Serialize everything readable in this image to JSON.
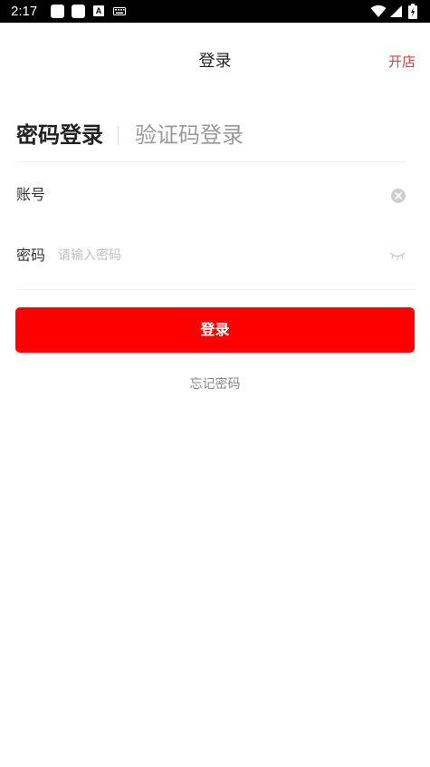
{
  "status_bar": {
    "time": "2:17",
    "icons": [
      "notification-square-icon",
      "notification-square-icon",
      "a-box-icon",
      "keyboard-icon",
      "wifi-icon",
      "signal-icon",
      "battery-icon"
    ]
  },
  "header": {
    "title": "登录",
    "action_label": "开店",
    "action_color": "#e4393c"
  },
  "tabs": {
    "active": "密码登录",
    "inactive": "验证码登录"
  },
  "form": {
    "account": {
      "label": "账号",
      "value": "",
      "placeholder": "",
      "trailing_icon": "clear-icon"
    },
    "password": {
      "label": "密码",
      "value": "",
      "placeholder": "请输入密码",
      "trailing_icon": "eye-closed-icon"
    }
  },
  "submit": {
    "label": "登录",
    "color": "#ff0000"
  },
  "forgot_password_label": "忘记密码"
}
